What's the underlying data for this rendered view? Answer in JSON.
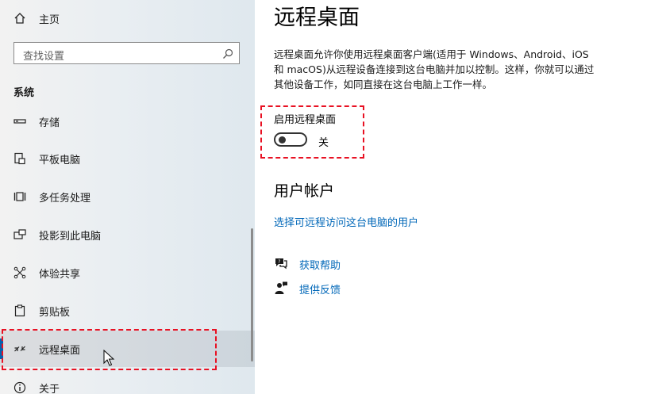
{
  "sidebar": {
    "home_label": "主页",
    "search_placeholder": "查找设置",
    "section_title": "系统",
    "items": [
      {
        "label": "存储",
        "icon": "storage-icon"
      },
      {
        "label": "平板电脑",
        "icon": "tablet-icon"
      },
      {
        "label": "多任务处理",
        "icon": "multitasking-icon"
      },
      {
        "label": "投影到此电脑",
        "icon": "projecting-icon"
      },
      {
        "label": "体验共享",
        "icon": "shared-experiences-icon"
      },
      {
        "label": "剪贴板",
        "icon": "clipboard-icon"
      },
      {
        "label": "远程桌面",
        "icon": "remote-desktop-icon",
        "selected": true
      },
      {
        "label": "关于",
        "icon": "info-icon"
      }
    ]
  },
  "main": {
    "title": "远程桌面",
    "description_lines": [
      "远程桌面允许你使用远程桌面客户端(适用于 Windows、Android、iOS",
      "和 macOS)从远程设备连接到这台电脑并加以控制。这样，你就可以通过",
      "其他设备工作，如同直接在这台电脑上工作一样。"
    ],
    "toggle_label": "启用远程桌面",
    "toggle_state": "关",
    "toggle_on": false,
    "user_accounts_heading": "用户帐户",
    "user_accounts_link": "选择可远程访问这台电脑的用户",
    "help_link": "获取帮助",
    "feedback_link": "提供反馈"
  },
  "colors": {
    "accent": "#0063b1",
    "link": "#0067b8",
    "highlight_border": "#e81123"
  }
}
